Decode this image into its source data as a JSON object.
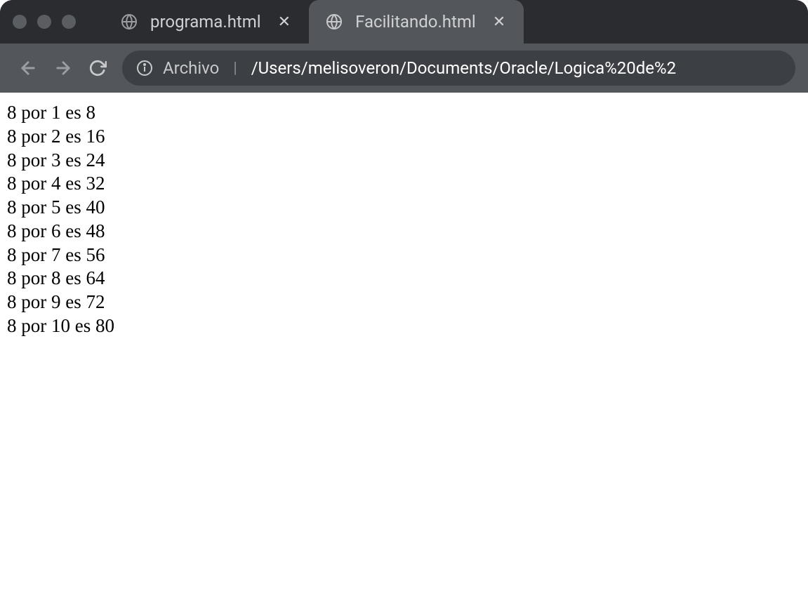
{
  "window": {
    "tabs": [
      {
        "title": "programa.html",
        "active": false
      },
      {
        "title": "Facilitando.html",
        "active": true
      }
    ]
  },
  "addressbar": {
    "label": "Archivo",
    "path": "/Users/melisoveron/Documents/Oracle/Logica%20de%2"
  },
  "content": {
    "lines": [
      "8 por 1 es 8",
      "8 por 2 es 16",
      "8 por 3 es 24",
      "8 por 4 es 32",
      "8 por 5 es 40",
      "8 por 6 es 48",
      "8 por 7 es 56",
      "8 por 8 es 64",
      "8 por 9 es 72",
      "8 por 10 es 80"
    ]
  }
}
